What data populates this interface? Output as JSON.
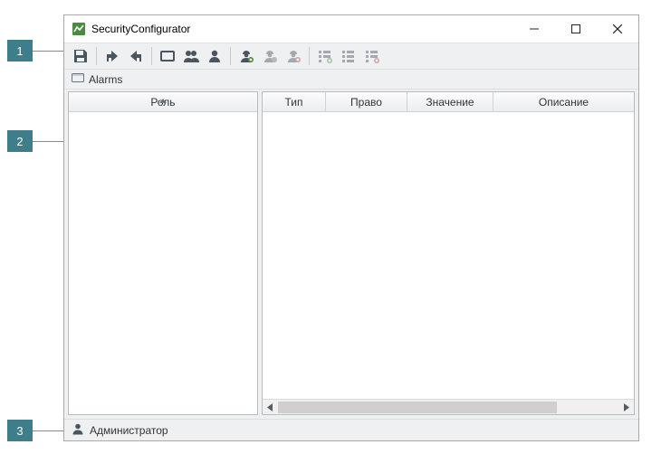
{
  "callouts": {
    "c1": "1",
    "c2": "2",
    "c3": "3"
  },
  "window": {
    "title": "SecurityConfigurator"
  },
  "breadcrumb": {
    "label": "Alarms"
  },
  "columns": {
    "role": "Роль",
    "type": "Тип",
    "right": "Право",
    "value": "Значение",
    "description": "Описание"
  },
  "status": {
    "user": "Администратор"
  }
}
